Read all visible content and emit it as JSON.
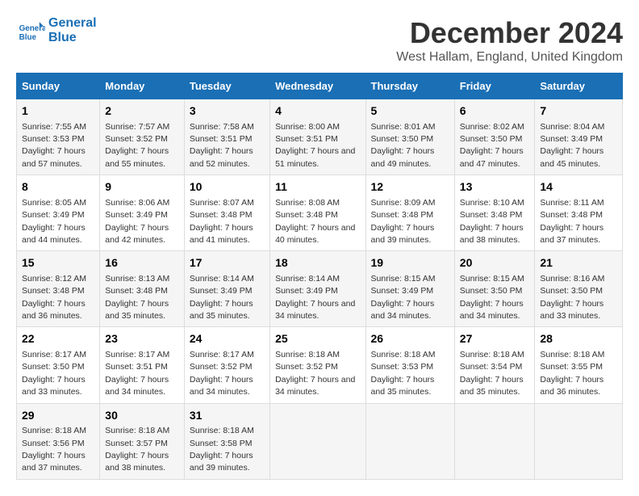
{
  "logo": {
    "line1": "General",
    "line2": "Blue"
  },
  "title": "December 2024",
  "subtitle": "West Hallam, England, United Kingdom",
  "days_of_week": [
    "Sunday",
    "Monday",
    "Tuesday",
    "Wednesday",
    "Thursday",
    "Friday",
    "Saturday"
  ],
  "weeks": [
    [
      {
        "day": "1",
        "sunrise": "7:55 AM",
        "sunset": "3:53 PM",
        "daylight": "7 hours and 57 minutes."
      },
      {
        "day": "2",
        "sunrise": "7:57 AM",
        "sunset": "3:52 PM",
        "daylight": "7 hours and 55 minutes."
      },
      {
        "day": "3",
        "sunrise": "7:58 AM",
        "sunset": "3:51 PM",
        "daylight": "7 hours and 52 minutes."
      },
      {
        "day": "4",
        "sunrise": "8:00 AM",
        "sunset": "3:51 PM",
        "daylight": "7 hours and 51 minutes."
      },
      {
        "day": "5",
        "sunrise": "8:01 AM",
        "sunset": "3:50 PM",
        "daylight": "7 hours and 49 minutes."
      },
      {
        "day": "6",
        "sunrise": "8:02 AM",
        "sunset": "3:50 PM",
        "daylight": "7 hours and 47 minutes."
      },
      {
        "day": "7",
        "sunrise": "8:04 AM",
        "sunset": "3:49 PM",
        "daylight": "7 hours and 45 minutes."
      }
    ],
    [
      {
        "day": "8",
        "sunrise": "8:05 AM",
        "sunset": "3:49 PM",
        "daylight": "7 hours and 44 minutes."
      },
      {
        "day": "9",
        "sunrise": "8:06 AM",
        "sunset": "3:49 PM",
        "daylight": "7 hours and 42 minutes."
      },
      {
        "day": "10",
        "sunrise": "8:07 AM",
        "sunset": "3:48 PM",
        "daylight": "7 hours and 41 minutes."
      },
      {
        "day": "11",
        "sunrise": "8:08 AM",
        "sunset": "3:48 PM",
        "daylight": "7 hours and 40 minutes."
      },
      {
        "day": "12",
        "sunrise": "8:09 AM",
        "sunset": "3:48 PM",
        "daylight": "7 hours and 39 minutes."
      },
      {
        "day": "13",
        "sunrise": "8:10 AM",
        "sunset": "3:48 PM",
        "daylight": "7 hours and 38 minutes."
      },
      {
        "day": "14",
        "sunrise": "8:11 AM",
        "sunset": "3:48 PM",
        "daylight": "7 hours and 37 minutes."
      }
    ],
    [
      {
        "day": "15",
        "sunrise": "8:12 AM",
        "sunset": "3:48 PM",
        "daylight": "7 hours and 36 minutes."
      },
      {
        "day": "16",
        "sunrise": "8:13 AM",
        "sunset": "3:48 PM",
        "daylight": "7 hours and 35 minutes."
      },
      {
        "day": "17",
        "sunrise": "8:14 AM",
        "sunset": "3:49 PM",
        "daylight": "7 hours and 35 minutes."
      },
      {
        "day": "18",
        "sunrise": "8:14 AM",
        "sunset": "3:49 PM",
        "daylight": "7 hours and 34 minutes."
      },
      {
        "day": "19",
        "sunrise": "8:15 AM",
        "sunset": "3:49 PM",
        "daylight": "7 hours and 34 minutes."
      },
      {
        "day": "20",
        "sunrise": "8:15 AM",
        "sunset": "3:50 PM",
        "daylight": "7 hours and 34 minutes."
      },
      {
        "day": "21",
        "sunrise": "8:16 AM",
        "sunset": "3:50 PM",
        "daylight": "7 hours and 33 minutes."
      }
    ],
    [
      {
        "day": "22",
        "sunrise": "8:17 AM",
        "sunset": "3:50 PM",
        "daylight": "7 hours and 33 minutes."
      },
      {
        "day": "23",
        "sunrise": "8:17 AM",
        "sunset": "3:51 PM",
        "daylight": "7 hours and 34 minutes."
      },
      {
        "day": "24",
        "sunrise": "8:17 AM",
        "sunset": "3:52 PM",
        "daylight": "7 hours and 34 minutes."
      },
      {
        "day": "25",
        "sunrise": "8:18 AM",
        "sunset": "3:52 PM",
        "daylight": "7 hours and 34 minutes."
      },
      {
        "day": "26",
        "sunrise": "8:18 AM",
        "sunset": "3:53 PM",
        "daylight": "7 hours and 35 minutes."
      },
      {
        "day": "27",
        "sunrise": "8:18 AM",
        "sunset": "3:54 PM",
        "daylight": "7 hours and 35 minutes."
      },
      {
        "day": "28",
        "sunrise": "8:18 AM",
        "sunset": "3:55 PM",
        "daylight": "7 hours and 36 minutes."
      }
    ],
    [
      {
        "day": "29",
        "sunrise": "8:18 AM",
        "sunset": "3:56 PM",
        "daylight": "7 hours and 37 minutes."
      },
      {
        "day": "30",
        "sunrise": "8:18 AM",
        "sunset": "3:57 PM",
        "daylight": "7 hours and 38 minutes."
      },
      {
        "day": "31",
        "sunrise": "8:18 AM",
        "sunset": "3:58 PM",
        "daylight": "7 hours and 39 minutes."
      },
      null,
      null,
      null,
      null
    ]
  ]
}
